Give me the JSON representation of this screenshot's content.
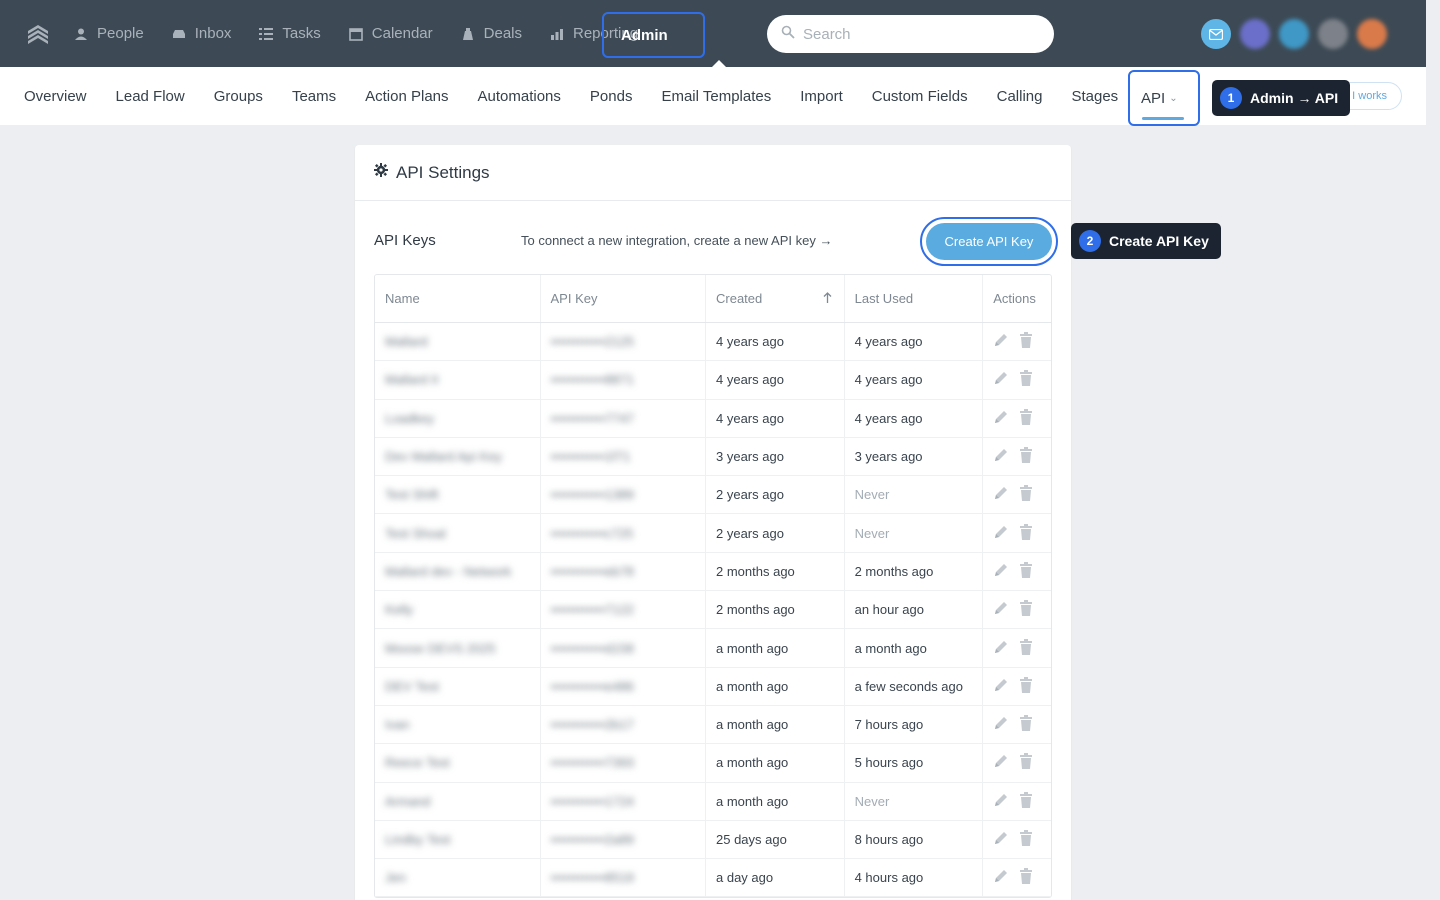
{
  "topnav": {
    "items": [
      {
        "label": "People",
        "icon": "person-icon"
      },
      {
        "label": "Inbox",
        "icon": "inbox-icon"
      },
      {
        "label": "Tasks",
        "icon": "tasks-icon"
      },
      {
        "label": "Calendar",
        "icon": "calendar-icon"
      },
      {
        "label": "Deals",
        "icon": "deals-icon"
      },
      {
        "label": "Reporting",
        "icon": "chart-icon"
      }
    ],
    "admin_label": "Admin",
    "search_placeholder": "Search"
  },
  "subnav": {
    "items": [
      "Overview",
      "Lead Flow",
      "Groups",
      "Teams",
      "Action Plans",
      "Automations",
      "Ponds",
      "Email Templates",
      "Import",
      "Custom Fields",
      "Calling",
      "Stages"
    ],
    "active_label": "API",
    "howworks_label": "I works"
  },
  "tips": {
    "tip1_num": "1",
    "tip1_text": "Admin → API",
    "tip2_num": "2",
    "tip2_text": "Create API Key"
  },
  "card": {
    "title": "API Settings",
    "keys_label": "API Keys",
    "hint": "To connect a new integration, create a new API key →",
    "create_button": "Create API Key"
  },
  "table": {
    "headers": {
      "name": "Name",
      "key": "API Key",
      "created": "Created",
      "last_used": "Last Used",
      "actions": "Actions"
    },
    "rows": [
      {
        "name": "Mallard",
        "key": "••••••••••••2125",
        "created": "4 years ago",
        "last_used": "4 years ago"
      },
      {
        "name": "Mallard II",
        "key": "••••••••••••8871",
        "created": "4 years ago",
        "last_used": "4 years ago"
      },
      {
        "name": "Loadkey",
        "key": "••••••••••••7747",
        "created": "4 years ago",
        "last_used": "4 years ago"
      },
      {
        "name": "Dev Mallard Api Key",
        "key": "••••••••••••1f71",
        "created": "3 years ago",
        "last_used": "3 years ago"
      },
      {
        "name": "Test Shift",
        "key": "••••••••••••1389",
        "created": "2 years ago",
        "last_used": "Never"
      },
      {
        "name": "Test Shoal",
        "key": "••••••••••••c725",
        "created": "2 years ago",
        "last_used": "Never"
      },
      {
        "name": "Mallard dev - Network",
        "key": "••••••••••••eb78",
        "created": "2 months ago",
        "last_used": "2 months ago"
      },
      {
        "name": "Kelly",
        "key": "••••••••••••7122",
        "created": "2 months ago",
        "last_used": "an hour ago"
      },
      {
        "name": "Moose DEVS 2025",
        "key": "••••••••••••d158",
        "created": "a month ago",
        "last_used": "a month ago"
      },
      {
        "name": "DEV Test",
        "key": "••••••••••••e486",
        "created": "a month ago",
        "last_used": "a few seconds ago"
      },
      {
        "name": "Ivan",
        "key": "••••••••••••2b17",
        "created": "a month ago",
        "last_used": "7 hours ago"
      },
      {
        "name": "Reece Test",
        "key": "••••••••••••7393",
        "created": "a month ago",
        "last_used": "5 hours ago"
      },
      {
        "name": "Armand",
        "key": "••••••••••••1724",
        "created": "a month ago",
        "last_used": "Never"
      },
      {
        "name": "Lindby Test",
        "key": "••••••••••••2a89",
        "created": "25 days ago",
        "last_used": "8 hours ago"
      },
      {
        "name": "Jen",
        "key": "••••••••••••8519",
        "created": "a day ago",
        "last_used": "4 hours ago"
      }
    ]
  },
  "colors": {
    "accent": "#2f6ee8",
    "button": "#5aabdf",
    "topbar": "#3d4a55"
  }
}
